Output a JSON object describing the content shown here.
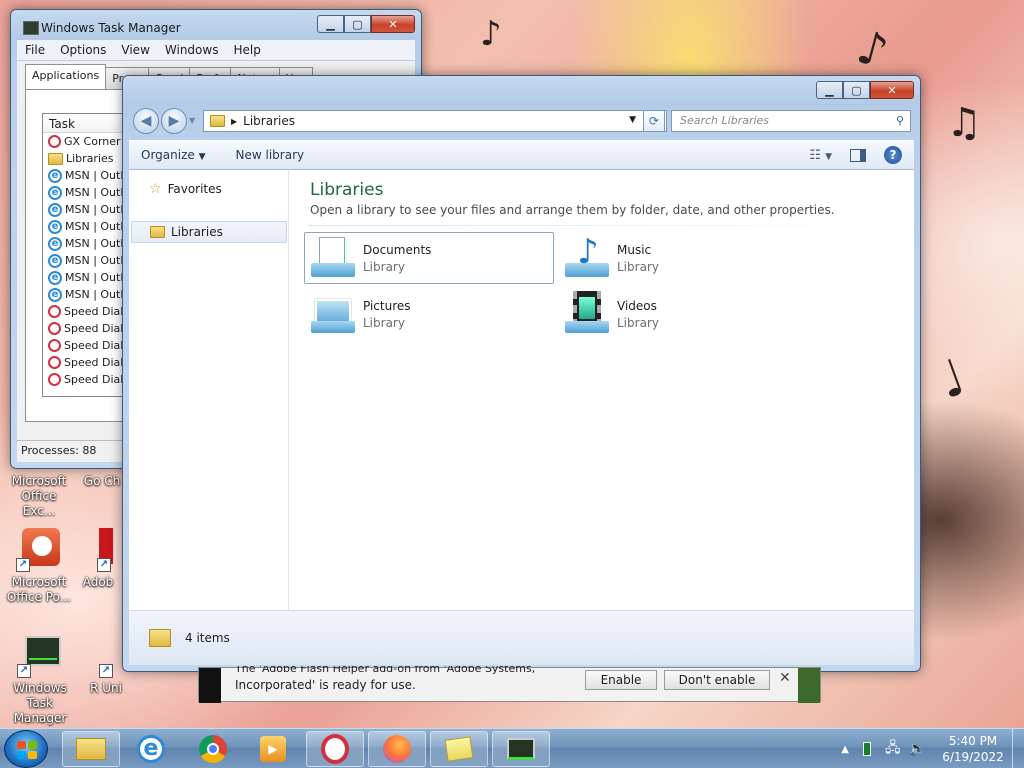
{
  "taskmanager": {
    "title": "Windows Task Manager",
    "menu": [
      "File",
      "Options",
      "View",
      "Windows",
      "Help"
    ],
    "tabs": [
      "Applications",
      "Proce",
      "Servi",
      "Perfo",
      "Netwo",
      "Use"
    ],
    "column": "Task",
    "rows": [
      {
        "icon": "opera",
        "label": "GX Corner -"
      },
      {
        "icon": "folder",
        "label": "Libraries"
      },
      {
        "icon": "ie",
        "label": "MSN | Outlo"
      },
      {
        "icon": "ie",
        "label": "MSN | Outlo"
      },
      {
        "icon": "ie",
        "label": "MSN | Outlo"
      },
      {
        "icon": "ie",
        "label": "MSN | Outlo"
      },
      {
        "icon": "ie",
        "label": "MSN | Outlo"
      },
      {
        "icon": "ie",
        "label": "MSN | Outlo"
      },
      {
        "icon": "ie",
        "label": "MSN | Outlo"
      },
      {
        "icon": "ie",
        "label": "MSN | Outlo"
      },
      {
        "icon": "opera",
        "label": "Speed Dial -"
      },
      {
        "icon": "opera",
        "label": "Speed Dial -"
      },
      {
        "icon": "opera",
        "label": "Speed Dial -"
      },
      {
        "icon": "opera",
        "label": "Speed Dial -"
      },
      {
        "icon": "opera",
        "label": "Speed Dial -"
      }
    ],
    "status": "Processes: 88"
  },
  "explorer": {
    "address": "Libraries",
    "search_placeholder": "Search Libraries",
    "organize": "Organize",
    "new_library": "New library",
    "nav": {
      "favorites": "Favorites",
      "libraries": "Libraries"
    },
    "heading": "Libraries",
    "subheading": "Open a library to see your files and arrange them by folder, date, and other properties.",
    "libraries": [
      {
        "name": "Documents",
        "type": "Library"
      },
      {
        "name": "Music",
        "type": "Library"
      },
      {
        "name": "Pictures",
        "type": "Library"
      },
      {
        "name": "Videos",
        "type": "Library"
      }
    ],
    "status": "4 items"
  },
  "desktop_icons": [
    {
      "label": "Microsoft Office Exc..."
    },
    {
      "label": "Go Ch"
    },
    {
      "label": "Microsoft Office Po..."
    },
    {
      "label": "Adob"
    },
    {
      "label": "Windows Task Manager"
    },
    {
      "label": "R Uni"
    }
  ],
  "notification": {
    "line1": "The 'Adobe Flash Helper add-on from 'Adobe Systems,",
    "line2": "Incorporated' is ready for use.",
    "enable": "Enable",
    "dont_enable": "Don't enable"
  },
  "clock": {
    "time": "5:40 PM",
    "date": "6/19/2022"
  }
}
